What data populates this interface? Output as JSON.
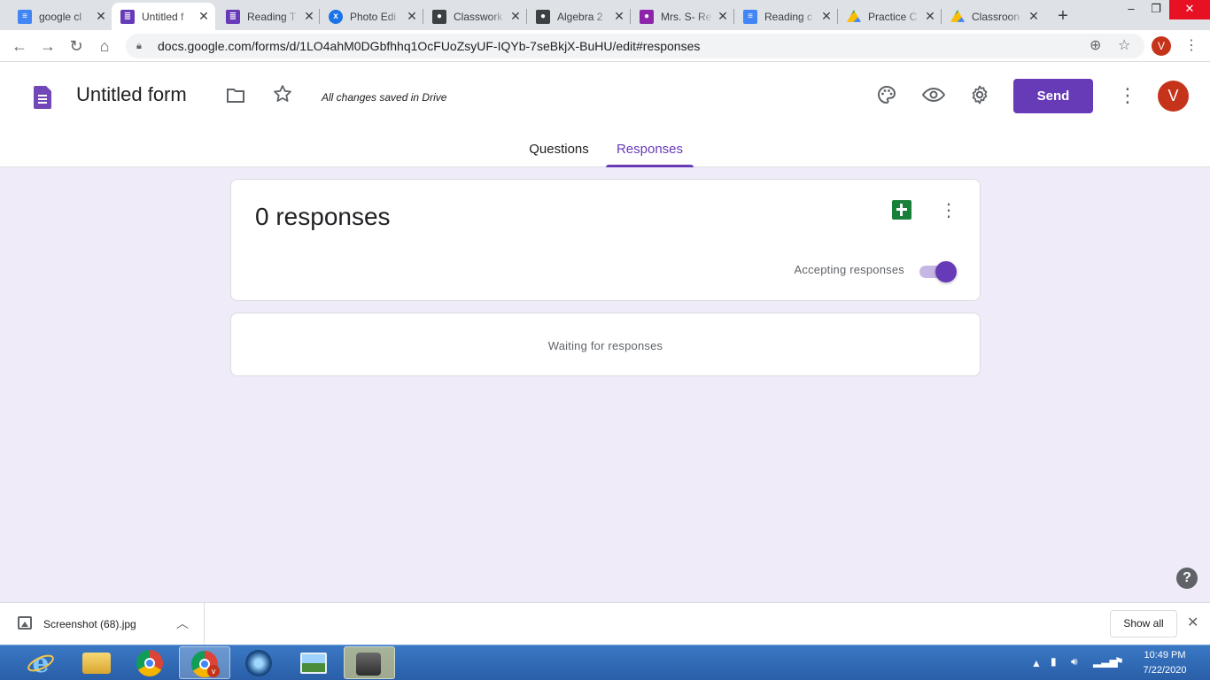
{
  "browser": {
    "tabs": [
      {
        "title": "google cl",
        "icon": "docs-icon",
        "color": "#4285f4",
        "active": false
      },
      {
        "title": "Untitled f",
        "icon": "forms-icon",
        "color": "#673ab7",
        "active": true
      },
      {
        "title": "Reading T",
        "icon": "forms-icon",
        "color": "#673ab7",
        "active": false
      },
      {
        "title": "Photo Edi",
        "icon": "photo-editor-icon",
        "color": "#1a73e8",
        "active": false
      },
      {
        "title": "Classwork",
        "icon": "classroom-icon",
        "color": "#3c4043",
        "active": false
      },
      {
        "title": "Algebra 2",
        "icon": "classroom-icon",
        "color": "#3c4043",
        "active": false
      },
      {
        "title": "Mrs. S- Re",
        "icon": "classroom-icon",
        "color": "#8e24aa",
        "active": false
      },
      {
        "title": "Reading c",
        "icon": "docs-icon",
        "color": "#4285f4",
        "active": false
      },
      {
        "title": "Practice C",
        "icon": "drive-icon",
        "color": "#0f9d58",
        "active": false
      },
      {
        "title": "Classroon",
        "icon": "drive-icon",
        "color": "#0f9d58",
        "active": false
      }
    ],
    "url": "docs.google.com/forms/d/1LO4ahM0DGbfhhq1OcFUoZsyUF-IQYb-7seBkjX-BuHU/edit#responses",
    "profile_initial": "V"
  },
  "form": {
    "title": "Untitled form",
    "saved_status": "All changes saved in Drive",
    "send_label": "Send",
    "avatar_initial": "V",
    "tabs": [
      "Questions",
      "Responses"
    ],
    "active_tab": "Responses"
  },
  "responses": {
    "count_label": "0 responses",
    "accepting_label": "Accepting responses",
    "accepting": true,
    "waiting_label": "Waiting for responses"
  },
  "download_bar": {
    "file_name": "Screenshot (68).jpg",
    "show_all_label": "Show all"
  },
  "taskbar": {
    "time": "10:49 PM",
    "date": "7/22/2020"
  },
  "colors": {
    "accent": "#673ab7",
    "background": "#f0ebf8",
    "avatar": "#c5341a",
    "sheets": "#188038"
  }
}
